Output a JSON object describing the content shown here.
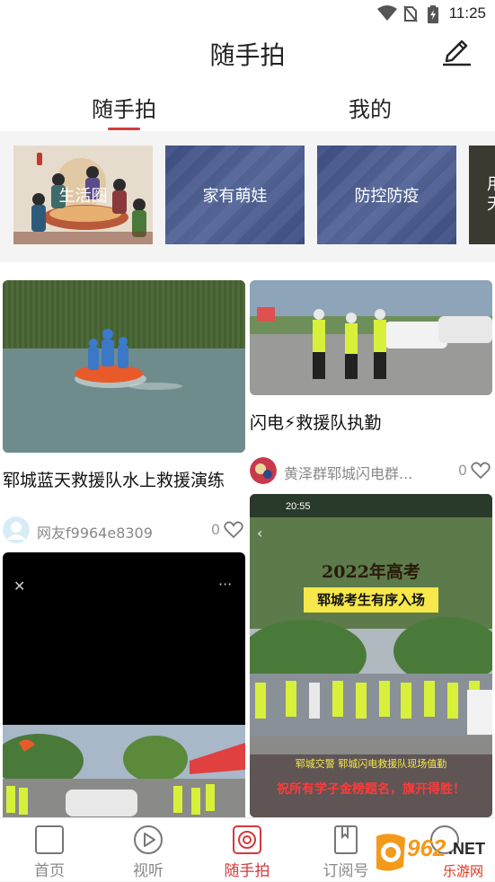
{
  "status_bar": {
    "time": "11:25"
  },
  "header": {
    "title": "随手拍"
  },
  "tabs": [
    {
      "label": "随手拍",
      "active": true
    },
    {
      "label": "我的",
      "active": false
    }
  ],
  "categories": [
    {
      "label": "生活圈"
    },
    {
      "label": "家有萌娃"
    },
    {
      "label": "防控防疫"
    },
    {
      "label": "用天"
    }
  ],
  "feed": {
    "card1": {
      "title": "郓城蓝天救援队水上救援演练",
      "user": "网友f9964e8309",
      "likes": "0"
    },
    "card2": {
      "title": "闪电⚡救援队执勤",
      "user": "黄泽群郓城闪电群...",
      "likes": "0"
    },
    "card3": {
      "close": "✕",
      "more": "···"
    },
    "card4": {
      "status_time": "20:55",
      "headline1": "2022年高考",
      "headline2": "郓城考生有序入场",
      "caption": "郓城交警 郓城闪电救援队现场值勤",
      "banner": "祝所有学子金榜题名，旗开得胜！"
    }
  },
  "bottom_nav": [
    {
      "label": "首页",
      "active": false
    },
    {
      "label": "视听",
      "active": false
    },
    {
      "label": "随手拍",
      "active": true
    },
    {
      "label": "订阅号",
      "active": false
    },
    {
      "label": "",
      "active": false
    }
  ],
  "watermark": {
    "brand": "962",
    "suffix": ".NET",
    "sub": "乐游网"
  },
  "colors": {
    "accent": "#d23b3b",
    "category_blue": "#4a5b8e"
  }
}
